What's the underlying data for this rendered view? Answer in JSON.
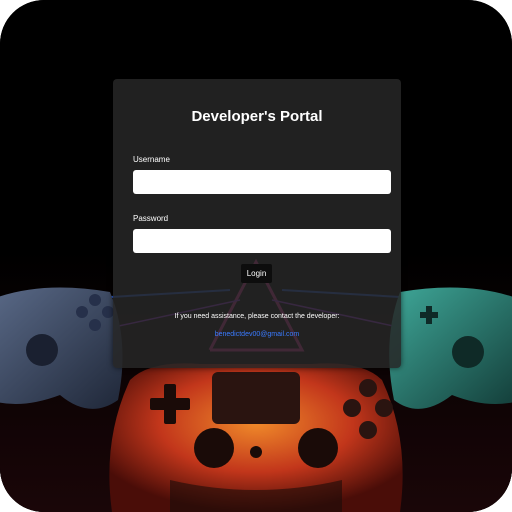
{
  "portal": {
    "title": "Developer's Portal",
    "username_label": "Username",
    "username_value": "",
    "password_label": "Password",
    "password_value": "",
    "login_label": "Login",
    "help_text": "If you need assistance, please contact the developer:",
    "contact_email": "benedictdev00@gmail.com"
  },
  "background": {
    "description_icons": [
      "gamepad-icon-left",
      "gamepad-icon-center",
      "gamepad-icon-right"
    ],
    "colors": {
      "base": "#000000",
      "glow_pink": "#ff3cac",
      "glow_blue": "#2b6bff",
      "controller_left": "#3a4a66",
      "controller_center": "#e0581c",
      "controller_right": "#2e7f76"
    }
  },
  "theme": {
    "card_bg": "#262626",
    "link_color": "#3a7bff",
    "button_bg": "#0d0d0d"
  }
}
